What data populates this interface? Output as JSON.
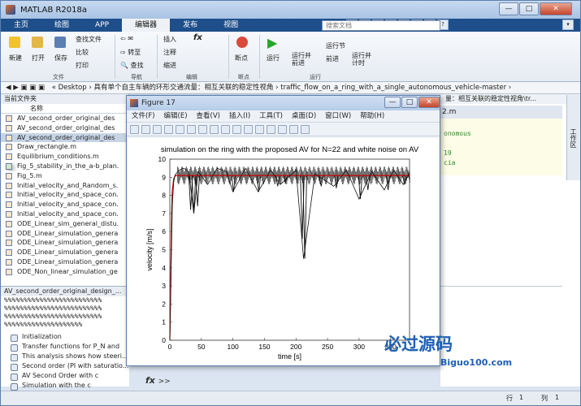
{
  "app": {
    "title": "MATLAB R2018a"
  },
  "window_controls": {
    "minimize": "—",
    "maximize": "□",
    "close": "✕"
  },
  "tabs": [
    "主页",
    "绘图",
    "APP",
    "编辑器",
    "发布",
    "视图"
  ],
  "search": {
    "placeholder": "搜索文档"
  },
  "ribbon": {
    "new": "新建",
    "open": "打开",
    "save": "保存",
    "find_files": "查找文件",
    "compare": "比较",
    "print": "打印",
    "goto": "转至",
    "find": "查找",
    "insert": "插入",
    "comment": "注释",
    "indent": "缩进",
    "fx": "fx",
    "breakpoints": "断点",
    "run": "运行",
    "run_advance": "运行并\n前进",
    "run_section": "运行节",
    "advance": "前进",
    "run_time": "运行并\n计时",
    "group_file": "文件",
    "group_nav": "导航",
    "group_edit": "编辑",
    "group_bp": "断点",
    "group_run": "运行"
  },
  "address": {
    "text": "« Desktop › 具有单个自主车辆的环形交通流量：相互关联的稳定性视角 › traffic_flow_on_a_ring_with_a_single_autonomous_vehicle-master ›"
  },
  "current_folder": {
    "title": "当前文件夹",
    "column": "名称",
    "files": [
      {
        "name": "AV_second_order_original_des",
        "type": "m"
      },
      {
        "name": "AV_second_order_original_des",
        "type": "m"
      },
      {
        "name": "AV_second_order_original_des",
        "type": "m",
        "selected": true
      },
      {
        "name": "Draw_rectangle.m",
        "type": "m"
      },
      {
        "name": "Equilibrium_conditions.m",
        "type": "m"
      },
      {
        "name": "Fig_5_stability_in_the_a-b_plan.",
        "type": "fig"
      },
      {
        "name": "Fig_5.m",
        "type": "m"
      },
      {
        "name": "Initial_velocity_and_Random_s.",
        "type": "m"
      },
      {
        "name": "Initial_velocity_and_space_con.",
        "type": "m"
      },
      {
        "name": "Initial_velocity_and_space_con.",
        "type": "m"
      },
      {
        "name": "Initial_velocity_and_space_con.",
        "type": "m"
      },
      {
        "name": "ODE_Linear_sim_general_distu.",
        "type": "m"
      },
      {
        "name": "ODE_Linear_simulation_genera",
        "type": "m"
      },
      {
        "name": "ODE_Linear_simulation_genera",
        "type": "m"
      },
      {
        "name": "ODE_Linear_simulation_genera",
        "type": "m"
      },
      {
        "name": "ODE_Linear_simulation_genera",
        "type": "m"
      },
      {
        "name": "ODE_Non_linear_simulation_ge",
        "type": "m"
      }
    ]
  },
  "details": {
    "title": "AV_second_order_original_design_...",
    "percent_lines": [
      "%%%%%%%%%%%%%%%%%%%%%%%%%",
      "%%%%%%%%%%%%%%%%%%%%%%%%%",
      "%%%%%%%%%%%%%%%%%%%%%%%%%",
      "%%%%%%%%%%%%%%%%%%%%"
    ],
    "items": [
      "Initialization",
      "Transfer functions for P_N and",
      "This analysis shows how steeri...",
      "Second order (PI with saturatio...",
      "AV Second Order with c",
      "Simulation with the c"
    ]
  },
  "editor": {
    "breadcrumb": "量：相互关联的稳定性视角\\tr...",
    "tab": "2.m",
    "code": [
      "onomous",
      "",
      "19",
      "cia"
    ]
  },
  "workspace": {
    "label": "工作区"
  },
  "command": {
    "prompt": ">>",
    "fx": "fx"
  },
  "status": {
    "row_label": "行",
    "row": "1",
    "col_label": "列",
    "col": "1"
  },
  "figure": {
    "title": "Figure 17",
    "menu": [
      "文件(F)",
      "编辑(E)",
      "查看(V)",
      "插入(I)",
      "工具(T)",
      "桌面(D)",
      "窗口(W)",
      "帮助(H)"
    ]
  },
  "chart_data": {
    "type": "line",
    "title": "simulation on the ring with the proposed AV for N=22 and white noise on AV",
    "xlabel": "time [s]",
    "ylabel": "velocity [m/s]",
    "xlim": [
      0,
      380
    ],
    "ylim": [
      0,
      10
    ],
    "xticks": [
      0,
      50,
      100,
      150,
      200,
      250,
      300,
      350
    ],
    "yticks": [
      0,
      1,
      2,
      3,
      4,
      5,
      6,
      7,
      8,
      9,
      10
    ],
    "series": [
      {
        "color": "#cc0000",
        "x": [
          0,
          1,
          2,
          3,
          4,
          6,
          8,
          10,
          15,
          380
        ],
        "y": [
          0,
          2.2,
          5.0,
          7.2,
          8.3,
          8.9,
          9.05,
          9.1,
          9.1,
          9.1
        ]
      },
      {
        "color": "#111111",
        "x": [
          0,
          2,
          4,
          6,
          8,
          10,
          15,
          22,
          30,
          38,
          45,
          60,
          75,
          90,
          100,
          120,
          140,
          160,
          175,
          200,
          212,
          230,
          260,
          280,
          300,
          320,
          340,
          355,
          370,
          380
        ],
        "y": [
          0,
          4.0,
          7.5,
          8.7,
          9.1,
          9.2,
          9.4,
          9.5,
          9.3,
          7.0,
          9.3,
          8.6,
          9.5,
          9.3,
          8.2,
          9.5,
          8.2,
          9.4,
          8.6,
          9.4,
          4.5,
          9.2,
          8.5,
          9.4,
          7.8,
          9.3,
          8.3,
          9.4,
          8.6,
          9.2
        ]
      }
    ],
    "envelope": {
      "color": "#111111",
      "upper": 9.6,
      "lower": 8.6
    },
    "dips": [
      {
        "x": 33,
        "y": 7.2
      },
      {
        "x": 38,
        "y": 7.0
      },
      {
        "x": 44,
        "y": 7.4
      },
      {
        "x": 101,
        "y": 8.2
      },
      {
        "x": 141,
        "y": 8.2
      },
      {
        "x": 171,
        "y": 8.5
      },
      {
        "x": 183,
        "y": 8.7
      },
      {
        "x": 210,
        "y": 5.6
      },
      {
        "x": 214,
        "y": 4.5
      },
      {
        "x": 240,
        "y": 8.5
      },
      {
        "x": 264,
        "y": 8.4
      },
      {
        "x": 302,
        "y": 7.8
      },
      {
        "x": 314,
        "y": 8.3
      },
      {
        "x": 346,
        "y": 8.3
      },
      {
        "x": 372,
        "y": 8.6
      }
    ],
    "grid": false
  },
  "watermark": {
    "main": "必过源码",
    "sub": "Biguo100.com"
  }
}
